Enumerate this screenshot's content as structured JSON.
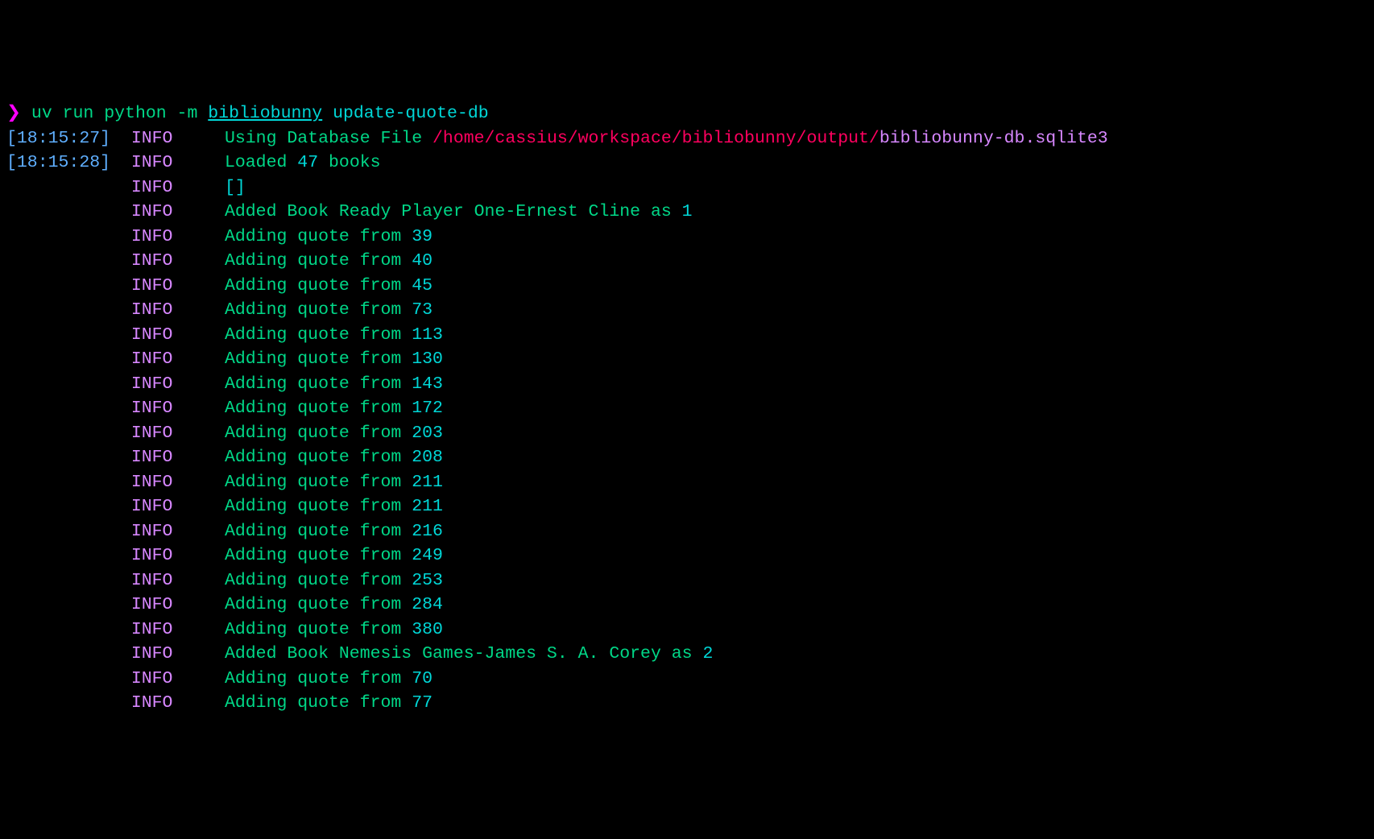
{
  "prompt": {
    "arrow": "❯",
    "cmd1": " uv run python -m ",
    "module": "bibliobunny",
    "cmd2": " update-quote-db"
  },
  "lines": [
    {
      "ts": "[18:15:27]",
      "level": "INFO",
      "parts": [
        {
          "t": "Using Database File ",
          "c": "msg-green"
        },
        {
          "t": "/home/cassius/workspace/bibliobunny/output/",
          "c": "path-red"
        },
        {
          "t": "bibliobunny-db.sqlite3",
          "c": "path-magenta"
        }
      ]
    },
    {
      "ts": "[18:15:28]",
      "level": "INFO",
      "parts": [
        {
          "t": "Loaded ",
          "c": "msg-green"
        },
        {
          "t": "47",
          "c": "msg-cyan"
        },
        {
          "t": " books",
          "c": "msg-green"
        }
      ]
    },
    {
      "ts": "",
      "level": "INFO",
      "parts": [
        {
          "t": "[]",
          "c": "msg-cyan"
        }
      ]
    },
    {
      "ts": "",
      "level": "INFO",
      "parts": [
        {
          "t": "Added Book Ready Player One-Ernest Cline as ",
          "c": "msg-green"
        },
        {
          "t": "1",
          "c": "msg-cyan"
        }
      ]
    },
    {
      "ts": "",
      "level": "INFO",
      "parts": [
        {
          "t": "Adding quote from ",
          "c": "msg-green"
        },
        {
          "t": "39",
          "c": "msg-cyan"
        }
      ]
    },
    {
      "ts": "",
      "level": "INFO",
      "parts": [
        {
          "t": "Adding quote from ",
          "c": "msg-green"
        },
        {
          "t": "40",
          "c": "msg-cyan"
        }
      ]
    },
    {
      "ts": "",
      "level": "INFO",
      "parts": [
        {
          "t": "Adding quote from ",
          "c": "msg-green"
        },
        {
          "t": "45",
          "c": "msg-cyan"
        }
      ]
    },
    {
      "ts": "",
      "level": "INFO",
      "parts": [
        {
          "t": "Adding quote from ",
          "c": "msg-green"
        },
        {
          "t": "73",
          "c": "msg-cyan"
        }
      ]
    },
    {
      "ts": "",
      "level": "INFO",
      "parts": [
        {
          "t": "Adding quote from ",
          "c": "msg-green"
        },
        {
          "t": "113",
          "c": "msg-cyan"
        }
      ]
    },
    {
      "ts": "",
      "level": "INFO",
      "parts": [
        {
          "t": "Adding quote from ",
          "c": "msg-green"
        },
        {
          "t": "130",
          "c": "msg-cyan"
        }
      ]
    },
    {
      "ts": "",
      "level": "INFO",
      "parts": [
        {
          "t": "Adding quote from ",
          "c": "msg-green"
        },
        {
          "t": "143",
          "c": "msg-cyan"
        }
      ]
    },
    {
      "ts": "",
      "level": "INFO",
      "parts": [
        {
          "t": "Adding quote from ",
          "c": "msg-green"
        },
        {
          "t": "172",
          "c": "msg-cyan"
        }
      ]
    },
    {
      "ts": "",
      "level": "INFO",
      "parts": [
        {
          "t": "Adding quote from ",
          "c": "msg-green"
        },
        {
          "t": "203",
          "c": "msg-cyan"
        }
      ]
    },
    {
      "ts": "",
      "level": "INFO",
      "parts": [
        {
          "t": "Adding quote from ",
          "c": "msg-green"
        },
        {
          "t": "208",
          "c": "msg-cyan"
        }
      ]
    },
    {
      "ts": "",
      "level": "INFO",
      "parts": [
        {
          "t": "Adding quote from ",
          "c": "msg-green"
        },
        {
          "t": "211",
          "c": "msg-cyan"
        }
      ]
    },
    {
      "ts": "",
      "level": "INFO",
      "parts": [
        {
          "t": "Adding quote from ",
          "c": "msg-green"
        },
        {
          "t": "211",
          "c": "msg-cyan"
        }
      ]
    },
    {
      "ts": "",
      "level": "INFO",
      "parts": [
        {
          "t": "Adding quote from ",
          "c": "msg-green"
        },
        {
          "t": "216",
          "c": "msg-cyan"
        }
      ]
    },
    {
      "ts": "",
      "level": "INFO",
      "parts": [
        {
          "t": "Adding quote from ",
          "c": "msg-green"
        },
        {
          "t": "249",
          "c": "msg-cyan"
        }
      ]
    },
    {
      "ts": "",
      "level": "INFO",
      "parts": [
        {
          "t": "Adding quote from ",
          "c": "msg-green"
        },
        {
          "t": "253",
          "c": "msg-cyan"
        }
      ]
    },
    {
      "ts": "",
      "level": "INFO",
      "parts": [
        {
          "t": "Adding quote from ",
          "c": "msg-green"
        },
        {
          "t": "284",
          "c": "msg-cyan"
        }
      ]
    },
    {
      "ts": "",
      "level": "INFO",
      "parts": [
        {
          "t": "Adding quote from ",
          "c": "msg-green"
        },
        {
          "t": "380",
          "c": "msg-cyan"
        }
      ]
    },
    {
      "ts": "",
      "level": "INFO",
      "parts": [
        {
          "t": "Added Book Nemesis Games-James S. A. Corey as ",
          "c": "msg-green"
        },
        {
          "t": "2",
          "c": "msg-cyan"
        }
      ]
    },
    {
      "ts": "",
      "level": "INFO",
      "parts": [
        {
          "t": "Adding quote from ",
          "c": "msg-green"
        },
        {
          "t": "70",
          "c": "msg-cyan"
        }
      ]
    },
    {
      "ts": "",
      "level": "INFO",
      "parts": [
        {
          "t": "Adding quote from ",
          "c": "msg-green"
        },
        {
          "t": "77",
          "c": "msg-cyan"
        }
      ]
    }
  ]
}
